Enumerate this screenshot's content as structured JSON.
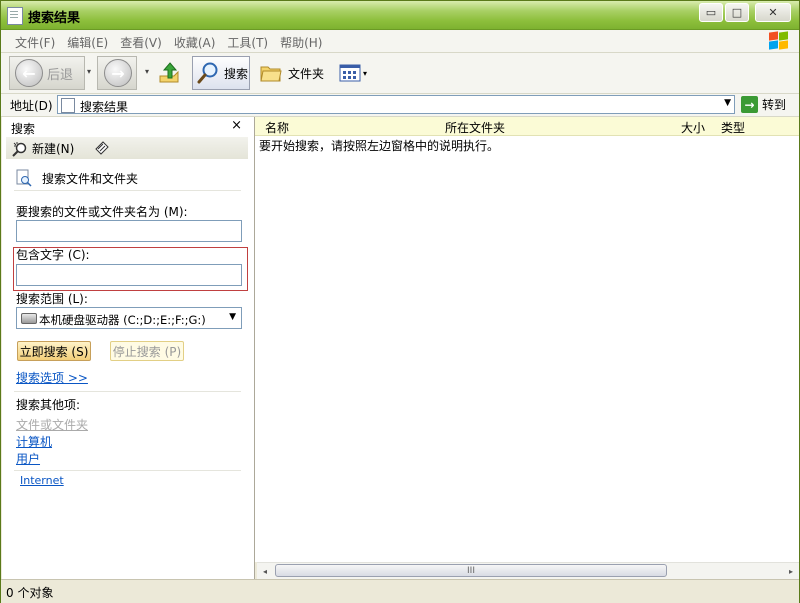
{
  "window": {
    "title": "搜索结果",
    "controls": {
      "minimize": "▭",
      "maximize": "□",
      "close": "✕"
    }
  },
  "menu": {
    "items": [
      "文件(F)",
      "编辑(E)",
      "查看(V)",
      "收藏(A)",
      "工具(T)",
      "帮助(H)"
    ]
  },
  "toolbar": {
    "back_label": "后退",
    "back_icon": "←",
    "forward_icon": "→",
    "dropdown": "▾",
    "search_label": "搜索",
    "folders_label": "文件夹"
  },
  "address": {
    "label": "地址(D)",
    "value": "搜索结果",
    "go_label": "转到",
    "go_icon": "→",
    "dropdown": "▼"
  },
  "search_pane": {
    "title": "搜索",
    "close": "×",
    "new_label": "新建(N)",
    "heading": "搜索文件和文件夹",
    "name_label": "要搜索的文件或文件夹名为 (M):",
    "name_value": "",
    "contains_label": "包含文字 (C):",
    "contains_value": "",
    "scope_label": "搜索范围 (L):",
    "scope_value": "本机硬盘驱动器 (C:;D:;E:;F:;G:)",
    "scope_dropdown": "▼",
    "search_now": "立即搜索 (S)",
    "stop_search": "停止搜索 (P)",
    "options_link": "搜索选项 >>",
    "other_heading": "搜索其他项:",
    "other_items": [
      "文件或文件夹",
      "计算机",
      "用户"
    ],
    "internet_link": "Internet"
  },
  "results": {
    "columns": [
      "名称",
      "所在文件夹",
      "大小",
      "类型"
    ],
    "message": "要开始搜索，请按照左边窗格中的说明执行。",
    "scroll_thumb": "III",
    "scroll_left": "◂",
    "scroll_right": "▸"
  },
  "status": {
    "text": "0 个对象"
  },
  "colors": {
    "titlebar": "#8dbf3c",
    "link": "#0a56c4",
    "highlight_border": "#c04040",
    "column_header_bg": "#fbfbd6"
  }
}
